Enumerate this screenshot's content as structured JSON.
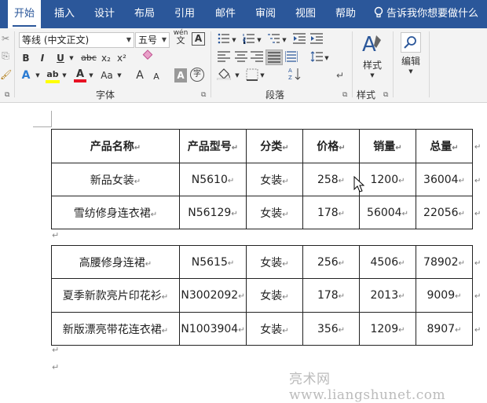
{
  "tabs": [
    "开始",
    "插入",
    "设计",
    "布局",
    "引用",
    "邮件",
    "审阅",
    "视图",
    "帮助"
  ],
  "tell_me": "告诉我你想要做什么",
  "font": {
    "name": "等线 (中文正文)",
    "size": "五号",
    "phonetic": "wén",
    "phonetic_char": "文",
    "border_char": "A",
    "bold": "B",
    "italic": "I",
    "underline": "U",
    "strike": "abc",
    "subscript": "x₂",
    "superscript": "x²",
    "change_case": "Aa",
    "grow": "A",
    "shrink": "A",
    "char_shade": "A",
    "enclose": "字",
    "highlight": "ab",
    "font_color": "A",
    "effects": "A"
  },
  "groups": {
    "font": "字体",
    "paragraph": "段落",
    "styles": "样式",
    "editing": "编辑"
  },
  "styles_label": "样式",
  "editing_label": "编辑",
  "colors": {
    "tabbar": "#2b579a",
    "highlight": "#ffff00",
    "font_color": "#e81123"
  },
  "table1": {
    "rows": [
      [
        "产品名称",
        "产品型号",
        "分类",
        "价格",
        "销量",
        "总量"
      ],
      [
        "新品女装",
        "N5610",
        "女装",
        "258",
        "1200",
        "36004"
      ],
      [
        "雪纺修身连衣裙",
        "N56129",
        "女装",
        "178",
        "56004",
        "22056"
      ]
    ]
  },
  "table2": {
    "rows": [
      [
        "高腰修身连裙",
        "N5615",
        "女装",
        "256",
        "4506",
        "78902"
      ],
      [
        "夏季新款亮片印花衫",
        "N3002092",
        "女装",
        "178",
        "2013",
        "9009"
      ],
      [
        "新版漂亮带花连衣裙",
        "N1003904",
        "女装",
        "356",
        "1209",
        "8907"
      ]
    ]
  },
  "cell_mark": "↵",
  "para_mark": "↵",
  "watermark": "亮术网 www.liangshunet.com"
}
